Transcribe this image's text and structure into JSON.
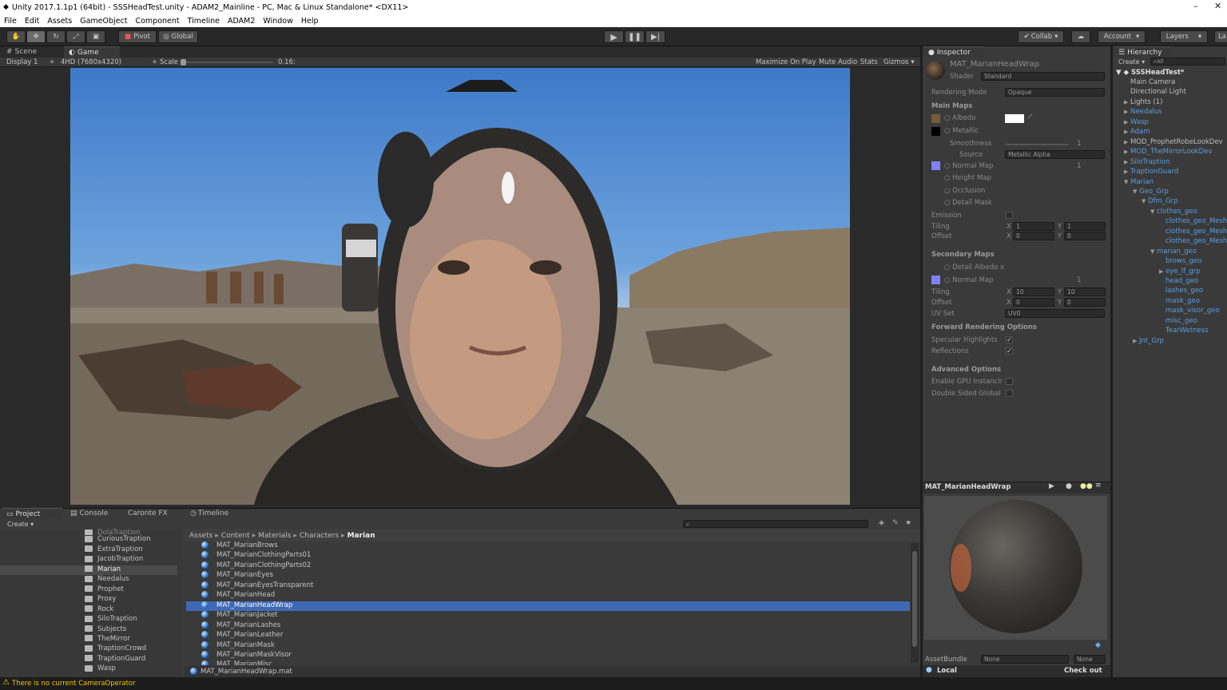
{
  "window": {
    "title": "Unity 2017.1.1p1 (64bit) - SSSHeadTest.unity - ADAM2_Mainline - PC, Mac & Linux Standalone* <DX11>"
  },
  "menu": [
    "File",
    "Edit",
    "Assets",
    "GameObject",
    "Component",
    "Timeline",
    "ADAM2",
    "Window",
    "Help"
  ],
  "toolbar": {
    "pivot": "Pivot",
    "global": "Global",
    "collab": "Collab",
    "account": "Account",
    "layers": "Layers",
    "layout": "La"
  },
  "scene_tabs": {
    "scene": "Scene",
    "game": "Game"
  },
  "game_bar": {
    "display": "Display 1",
    "resolution": "4HD (7680x4320)",
    "scale_label": "Scale",
    "scale_value": "0.16:",
    "maximize": "Maximize On Play",
    "mute": "Mute Audio",
    "stats": "Stats",
    "gizmos": "Gizmos"
  },
  "inspector": {
    "tab": "Inspector",
    "material": "MAT_MarianHeadWrap",
    "shader_label": "Shader",
    "shader_value": "Standard",
    "rendering_mode_label": "Rendering Mode",
    "rendering_mode_value": "Opaque",
    "main_maps": "Main Maps",
    "albedo": "Albedo",
    "metallic": "Metallic",
    "smoothness": "Smoothness",
    "smoothness_value": "1",
    "source_label": "Source",
    "source_value": "Metallic Alpha",
    "normal_map": "Normal Map",
    "normal_value": "1",
    "height_map": "Height Map",
    "occlusion": "Occlusion",
    "detail_mask": "Detail Mask",
    "emission": "Emission",
    "tiling": "Tiling",
    "offset": "Offset",
    "x": "X",
    "y": "Y",
    "one": "1",
    "zero": "0",
    "secondary_maps": "Secondary Maps",
    "detail_albedo": "Detail Albedo x",
    "normal_map2": "Normal Map",
    "normal_value2": "1",
    "tiling2_x": "10",
    "tiling2_y": "10",
    "uv_set_label": "UV Set",
    "uv_set_value": "UV0",
    "forward_options": "Forward Rendering Options",
    "specular": "Specular Highlights",
    "reflections": "Reflections",
    "advanced": "Advanced Options",
    "gpu_instancing": "Enable GPU Instancir",
    "double_sided": "Double Sided Global",
    "preview_title": "MAT_MarianHeadWrap",
    "assetbundle_label": "AssetBundle",
    "assetbundle_value": "None",
    "assetbundle_variant": "None"
  },
  "hierarchy": {
    "tab": "Hierarchy",
    "create": "Create",
    "search": "All",
    "scene": "SSSHeadTest*",
    "items": [
      {
        "label": "Main Camera",
        "indent": 0,
        "prefab": false,
        "arrow": ""
      },
      {
        "label": "Directional Light",
        "indent": 0,
        "prefab": false,
        "arrow": ""
      },
      {
        "label": "Lights (1)",
        "indent": 0,
        "prefab": false,
        "arrow": "▶"
      },
      {
        "label": "Needalus",
        "indent": 0,
        "prefab": true,
        "arrow": "▶"
      },
      {
        "label": "Wasp",
        "indent": 0,
        "prefab": true,
        "arrow": "▶"
      },
      {
        "label": "Adam",
        "indent": 0,
        "prefab": true,
        "arrow": "▶"
      },
      {
        "label": "MOD_ProphetRobeLookDev",
        "indent": 0,
        "prefab": false,
        "arrow": "▶"
      },
      {
        "label": "MOD_TheMirrorLookDev",
        "indent": 0,
        "prefab": true,
        "arrow": "▶"
      },
      {
        "label": "SiloTraption",
        "indent": 0,
        "prefab": true,
        "arrow": "▶"
      },
      {
        "label": "TraptionGuard",
        "indent": 0,
        "prefab": true,
        "arrow": "▶"
      },
      {
        "label": "Marian",
        "indent": 0,
        "prefab": true,
        "arrow": "▼"
      },
      {
        "label": "Geo_Grp",
        "indent": 1,
        "prefab": true,
        "arrow": "▼"
      },
      {
        "label": "Dfm_Grp",
        "indent": 2,
        "prefab": true,
        "arrow": "▼"
      },
      {
        "label": "clothes_geo",
        "indent": 3,
        "prefab": true,
        "arrow": "▼"
      },
      {
        "label": "clothes_geo_Mesh",
        "indent": 4,
        "prefab": true,
        "arrow": ""
      },
      {
        "label": "clothes_geo_Mesh",
        "indent": 4,
        "prefab": true,
        "arrow": ""
      },
      {
        "label": "clothes_geo_Mesh",
        "indent": 4,
        "prefab": true,
        "arrow": ""
      },
      {
        "label": "marian_geo",
        "indent": 3,
        "prefab": true,
        "arrow": "▼"
      },
      {
        "label": "brows_geo",
        "indent": 4,
        "prefab": true,
        "arrow": ""
      },
      {
        "label": "eye_lf_grp",
        "indent": 4,
        "prefab": true,
        "arrow": "▶"
      },
      {
        "label": "head_geo",
        "indent": 4,
        "prefab": true,
        "arrow": ""
      },
      {
        "label": "lashes_geo",
        "indent": 4,
        "prefab": true,
        "arrow": ""
      },
      {
        "label": "mask_geo",
        "indent": 4,
        "prefab": true,
        "arrow": ""
      },
      {
        "label": "mask_visor_geo",
        "indent": 4,
        "prefab": true,
        "arrow": ""
      },
      {
        "label": "misc_geo",
        "indent": 4,
        "prefab": true,
        "arrow": ""
      },
      {
        "label": "TearWetness",
        "indent": 4,
        "prefab": true,
        "arrow": ""
      },
      {
        "label": "Jnt_Grp",
        "indent": 1,
        "prefab": true,
        "arrow": "▶"
      }
    ]
  },
  "bottom_tabs": {
    "project": "Project",
    "console": "Console",
    "caronte": "Caronte FX",
    "timeline": "Timeline",
    "create": "Create"
  },
  "folders": [
    "DolaTraption",
    "CuriousTraption",
    "ExtraTraption",
    "JacobTraption",
    "Marian",
    "Needalus",
    "Prophet",
    "Proxy",
    "Rock",
    "SiloTraption",
    "Subjects",
    "TheMirror",
    "TraptionCrowd",
    "TraptionGuard",
    "Wasp"
  ],
  "breadcrumb": [
    "Assets",
    "Content",
    "Materials",
    "Characters",
    "Marian"
  ],
  "assets": [
    "MAT_MarianBrows",
    "MAT_MarianClothingParts01",
    "MAT_MarianClothingParts02",
    "MAT_MarianEyes",
    "MAT_MarianEyesTransparent",
    "MAT_MarianHead",
    "MAT_MarianHeadWrap",
    "MAT_MarianJacket",
    "MAT_MarianLashes",
    "MAT_MarianLeather",
    "MAT_MarianMask",
    "MAT_MarianMaskVisor",
    "MAT_MarianMisc"
  ],
  "selected_asset": "MAT_MarianHeadWrap",
  "footer": {
    "selected_file": "MAT_MarianHeadWrap.mat",
    "local": "Local",
    "checkout": "Check out",
    "status": "There is no current CameraOperator"
  }
}
